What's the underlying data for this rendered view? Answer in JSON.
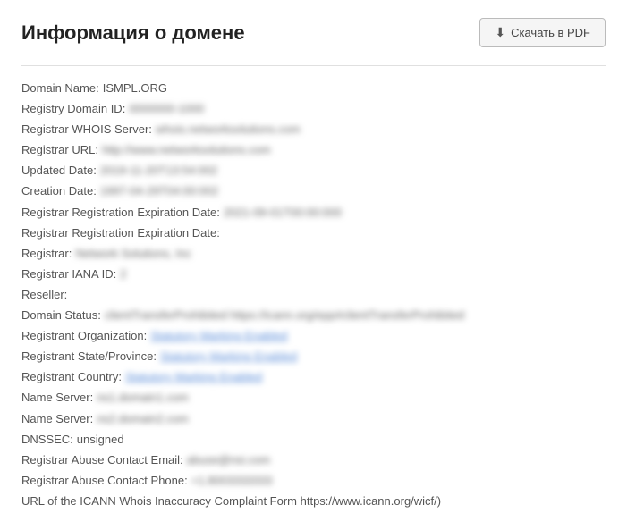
{
  "header": {
    "title": "Информация о домене",
    "download_label": "Скачать в PDF"
  },
  "whois": {
    "rows": [
      {
        "label": "Domain Name:",
        "value": "ISMPL.ORG",
        "blurred": false,
        "link": false
      },
      {
        "label": "Registry Domain ID:",
        "value": "0000000-1000",
        "blurred": true,
        "link": false
      },
      {
        "label": "Registrar WHOIS Server:",
        "value": "whois.networksolutions.com",
        "blurred": true,
        "link": false
      },
      {
        "label": "Registrar URL:",
        "value": "http://www.networksolutions.com",
        "blurred": true,
        "link": false
      },
      {
        "label": "Updated Date:",
        "value": "2019-11-20T13:54:002",
        "blurred": true,
        "link": false
      },
      {
        "label": "Creation Date:",
        "value": "1997-04-29T04:00:002",
        "blurred": true,
        "link": false
      },
      {
        "label": "Registrar Registration Expiration Date:",
        "value": "2021-09-01T00:00:000",
        "blurred": true,
        "link": false
      },
      {
        "label": "Registrar Registration Expiration Date:",
        "value": "",
        "blurred": false,
        "link": false
      },
      {
        "label": "Registrar:",
        "value": "Network Solutions, Inc",
        "blurred": true,
        "link": false
      },
      {
        "label": "Registrar IANA ID:",
        "value": "2",
        "blurred": true,
        "link": false
      },
      {
        "label": "Reseller:",
        "value": "",
        "blurred": false,
        "link": false
      },
      {
        "label": "Domain Status:",
        "value": "clientTransferProhibited https://icann.org/epp#clientTransferProhibited",
        "blurred": true,
        "link": false
      },
      {
        "label": "Registrant Organization:",
        "value": "Statutory Marking Enabled",
        "blurred": true,
        "link": true
      },
      {
        "label": "Registrant State/Province:",
        "value": "Statutory Marking Enabled",
        "blurred": true,
        "link": true
      },
      {
        "label": "Registrant Country:",
        "value": "Statutory Marking Enabled",
        "blurred": true,
        "link": true
      },
      {
        "label": "Name Server:",
        "value": "ns1.domain1.com",
        "blurred": true,
        "link": false
      },
      {
        "label": "Name Server:",
        "value": "ns2.domain2.com",
        "blurred": true,
        "link": false
      },
      {
        "label": "DNSSEC:",
        "value": "unsigned",
        "blurred": false,
        "link": false
      },
      {
        "label": "Registrar Abuse Contact Email:",
        "value": "abuse@nsi.com",
        "blurred": true,
        "link": false
      },
      {
        "label": "Registrar Abuse Contact Phone:",
        "value": "+1.8003333333",
        "blurred": true,
        "link": false
      },
      {
        "label": "URL of the ICANN Whois Inaccuracy Complaint Form https://www.icann.org/wicf/)",
        "value": "",
        "blurred": false,
        "link": false
      }
    ]
  }
}
